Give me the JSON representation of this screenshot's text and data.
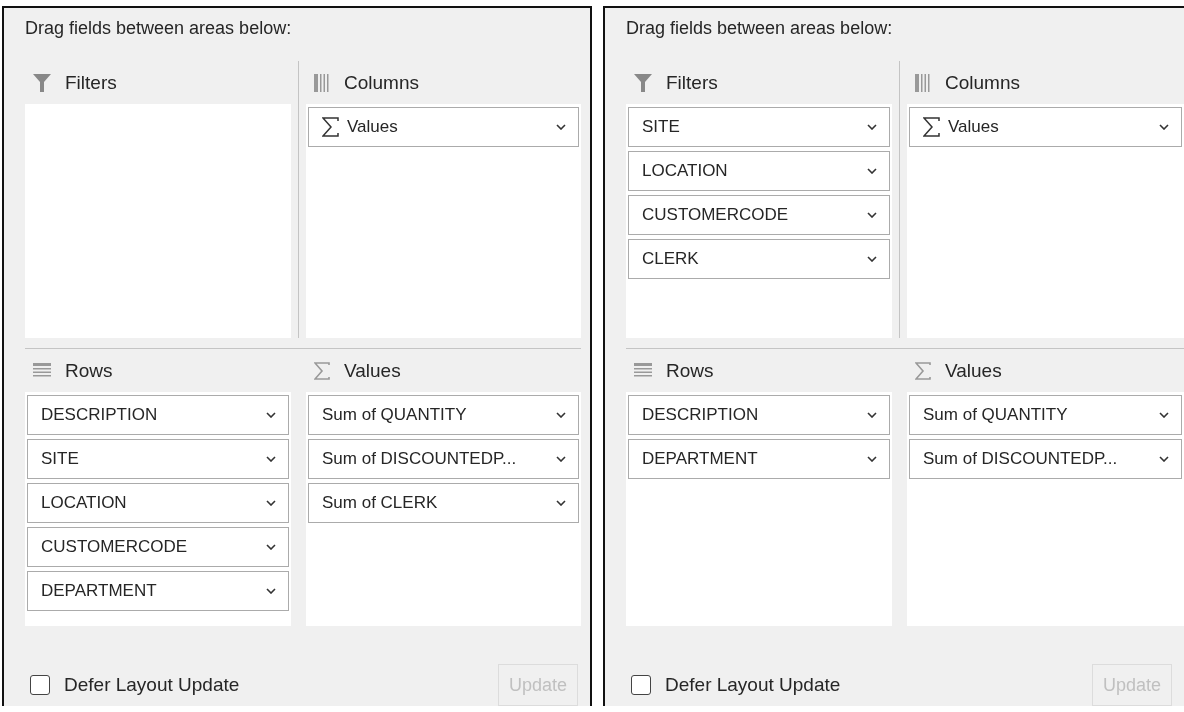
{
  "panels": [
    {
      "instruction": "Drag fields between areas below:",
      "areas": [
        {
          "kind": "filters",
          "label": "Filters"
        },
        {
          "kind": "columns",
          "label": "Columns",
          "items": [
            {
              "kind": "values",
              "label": "Values"
            }
          ]
        },
        {
          "kind": "rows",
          "label": "Rows",
          "items": [
            {
              "kind": "field",
              "label": "DESCRIPTION"
            },
            {
              "kind": "field",
              "label": "SITE"
            },
            {
              "kind": "field",
              "label": "LOCATION"
            },
            {
              "kind": "field",
              "label": "CUSTOMERCODE"
            },
            {
              "kind": "field",
              "label": "DEPARTMENT"
            }
          ]
        },
        {
          "kind": "values",
          "label": "Values",
          "items": [
            {
              "kind": "field",
              "label": "Sum of QUANTITY"
            },
            {
              "kind": "field",
              "label": "Sum of DISCOUNTEDP..."
            },
            {
              "kind": "field",
              "label": "Sum of CLERK"
            }
          ]
        }
      ],
      "defer": {
        "label": "Defer Layout Update",
        "checked": false
      },
      "update": {
        "label": "Update",
        "disabled": true
      }
    },
    {
      "instruction": "Drag fields between areas below:",
      "areas": [
        {
          "kind": "filters",
          "label": "Filters",
          "items": [
            {
              "kind": "field",
              "label": "SITE"
            },
            {
              "kind": "field",
              "label": "LOCATION"
            },
            {
              "kind": "field",
              "label": "CUSTOMERCODE"
            },
            {
              "kind": "field",
              "label": "CLERK"
            }
          ]
        },
        {
          "kind": "columns",
          "label": "Columns",
          "items": [
            {
              "kind": "values",
              "label": "Values"
            }
          ]
        },
        {
          "kind": "rows",
          "label": "Rows",
          "items": [
            {
              "kind": "field",
              "label": "DESCRIPTION"
            },
            {
              "kind": "field",
              "label": "DEPARTMENT"
            }
          ]
        },
        {
          "kind": "values",
          "label": "Values",
          "items": [
            {
              "kind": "field",
              "label": "Sum of QUANTITY"
            },
            {
              "kind": "field",
              "label": "Sum of DISCOUNTEDP..."
            }
          ]
        }
      ],
      "defer": {
        "label": "Defer Layout Update",
        "checked": false
      },
      "update": {
        "label": "Update",
        "disabled": true
      }
    }
  ]
}
